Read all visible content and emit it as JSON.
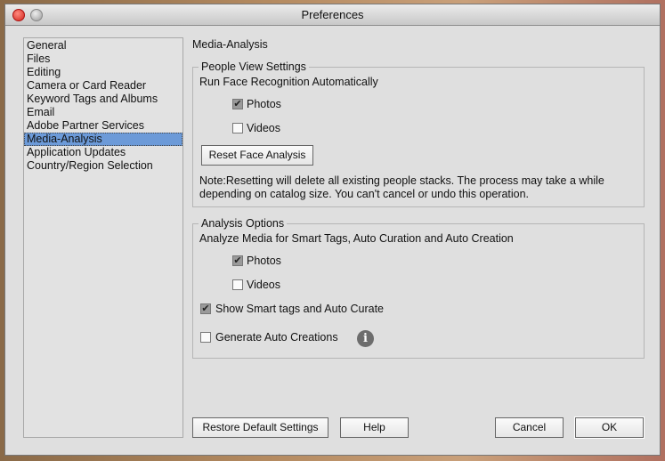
{
  "window": {
    "title": "Preferences"
  },
  "sidebar": {
    "items": [
      "General",
      "Files",
      "Editing",
      "Camera or Card Reader",
      "Keyword Tags and Albums",
      "Email",
      "Adobe Partner Services",
      "Media-Analysis",
      "Application Updates",
      "Country/Region Selection"
    ],
    "selected": "Media-Analysis"
  },
  "main": {
    "title": "Media-Analysis",
    "people": {
      "legend": "People View Settings",
      "heading": "Run Face Recognition Automatically",
      "photos": {
        "label": "Photos",
        "checked": true
      },
      "videos": {
        "label": "Videos",
        "checked": false
      },
      "reset_button": "Reset Face Analysis",
      "note_line1": "Note:Resetting will delete all existing people stacks. The process may take a while",
      "note_line2": "depending on catalog size. You can't cancel or undo this operation."
    },
    "analysis": {
      "legend": "Analysis Options",
      "heading": "Analyze Media for Smart Tags, Auto Curation and Auto Creation",
      "photos": {
        "label": "Photos",
        "checked": true
      },
      "videos": {
        "label": "Videos",
        "checked": false
      },
      "smart_tags": {
        "label": "Show Smart tags and Auto Curate",
        "checked": true
      },
      "auto_creations": {
        "label": "Generate Auto Creations",
        "checked": false
      }
    }
  },
  "buttons": {
    "restore": "Restore Default Settings",
    "help": "Help",
    "cancel": "Cancel",
    "ok": "OK"
  },
  "check_glyph": "✔"
}
